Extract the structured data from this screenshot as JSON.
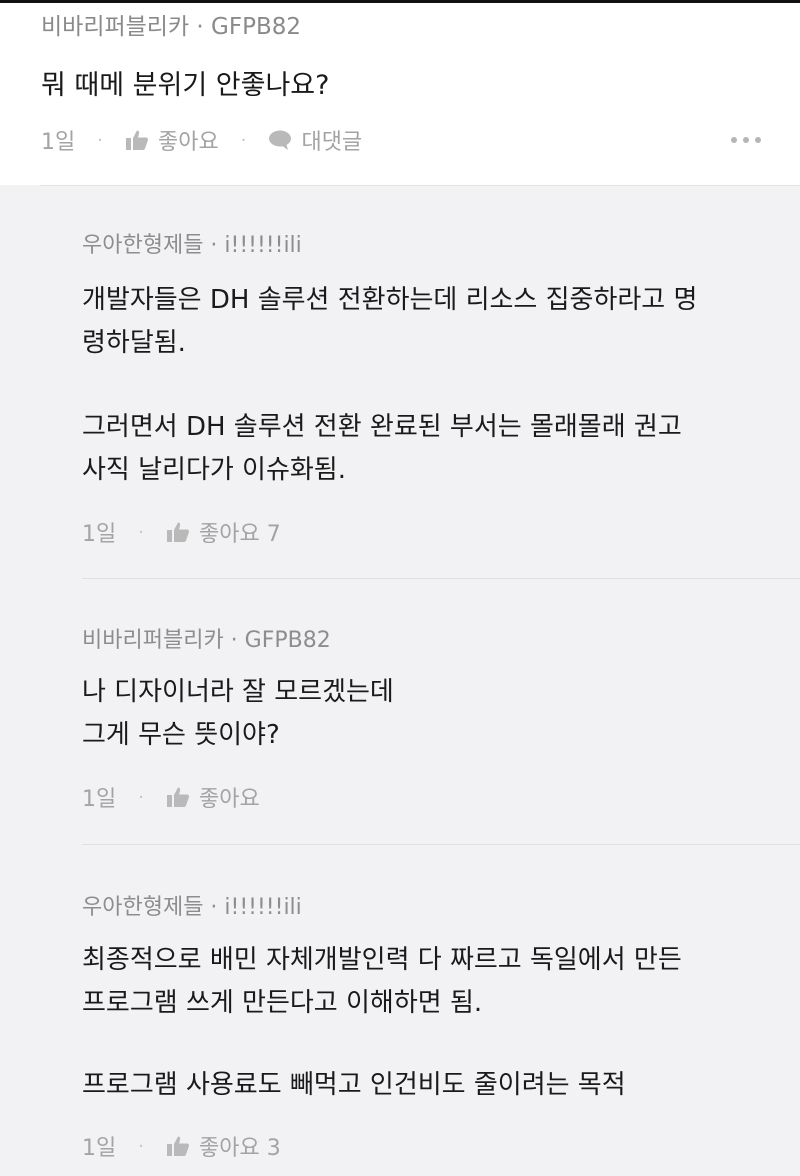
{
  "post": {
    "author": "비바리퍼블리카 · GFPB82",
    "body": "뭐 때메 분위기 안좋나요?",
    "time": "1일",
    "like_label": "좋아요",
    "reply_label": "대댓글"
  },
  "replies": [
    {
      "author": "우아한형제들 · i!!!!!!ili",
      "paragraphs": [
        [
          "개발자들은 DH 솔루션 전환하는데 리소스 집중하라고 명",
          "령하달됨."
        ],
        [
          "그러면서 DH 솔루션 전환 완료된 부서는 몰래몰래 권고",
          "사직 날리다가 이슈화됨."
        ]
      ],
      "time": "1일",
      "like_label": "좋아요 7"
    },
    {
      "author": "비바리퍼블리카 · GFPB82",
      "paragraphs": [
        [
          "나 디자이너라 잘 모르겠는데",
          "그게 무슨 뜻이야?"
        ]
      ],
      "time": "1일",
      "like_label": "좋아요"
    },
    {
      "author": "우아한형제들 · i!!!!!!ili",
      "paragraphs": [
        [
          "최종적으로 배민 자체개발인력 다 짜르고 독일에서 만든",
          "프로그램 쓰게 만든다고 이해하면 됨."
        ],
        [
          "프로그램 사용료도 빼먹고 인건비도 줄이려는 목적"
        ]
      ],
      "time": "1일",
      "like_label": "좋아요 3"
    }
  ],
  "icons": {
    "like": "thumbs-up-icon",
    "reply": "speech-bubble-icon",
    "more": "more-dots-icon"
  },
  "colors": {
    "reply_background": "#f2f2f4",
    "meta_text": "#a3a3a3",
    "icon": "#b9b9b9"
  }
}
